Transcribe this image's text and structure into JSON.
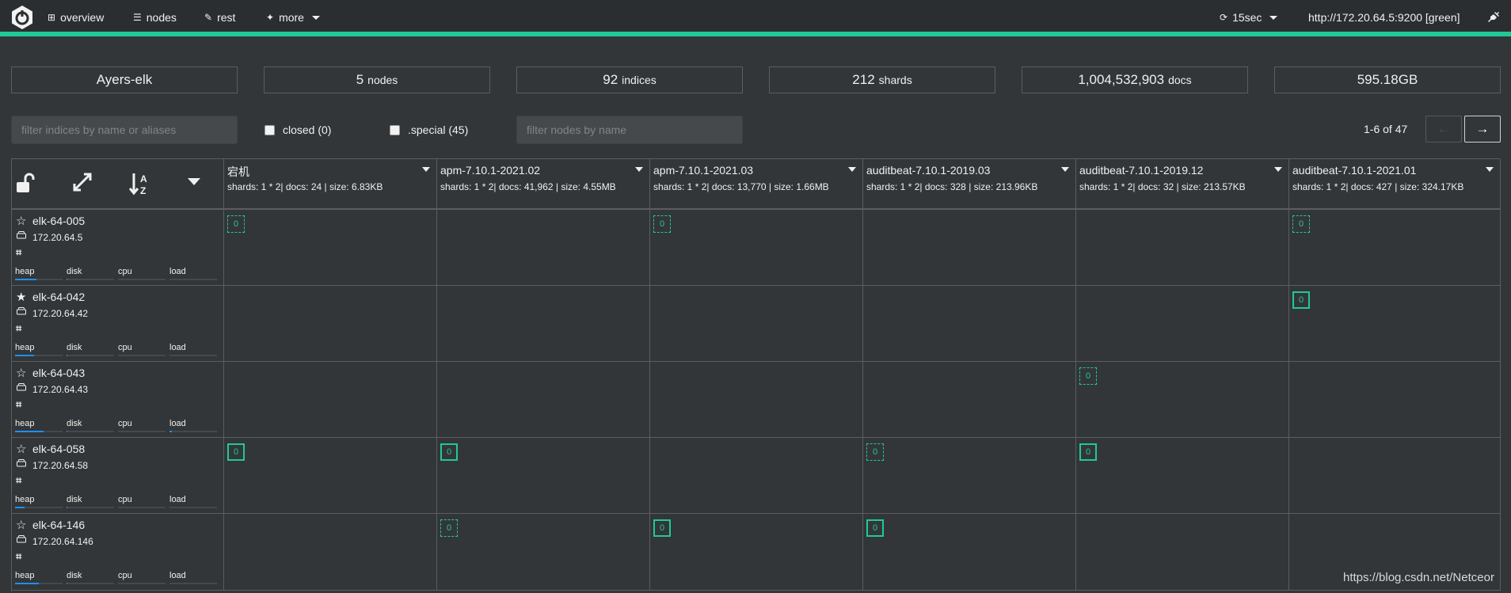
{
  "navbar": {
    "items": [
      {
        "label": "overview",
        "icon": "sitemap-icon"
      },
      {
        "label": "nodes",
        "icon": "server-icon"
      },
      {
        "label": "rest",
        "icon": "edit-icon"
      },
      {
        "label": "more",
        "icon": "wand-icon"
      }
    ],
    "refresh": "15sec",
    "cluster_url": "http://172.20.64.5:9200 [green]"
  },
  "stats": {
    "cluster_name": "Ayers-elk",
    "nodes_count": "5",
    "nodes_label": "nodes",
    "indices_count": "92",
    "indices_label": "indices",
    "shards_count": "212",
    "shards_label": "shards",
    "docs_count": "1,004,532,903",
    "docs_label": "docs",
    "size": "595.18GB"
  },
  "filters": {
    "indices_placeholder": "filter indices by name or aliases",
    "closed_label": "closed (0)",
    "special_label": ".special (45)",
    "nodes_placeholder": "filter nodes by name",
    "pagination": "1-6 of 47",
    "prev": "←",
    "next": "→"
  },
  "indices": [
    {
      "name": "宕机",
      "meta": "shards: 1 * 2| docs: 24 | size: 6.83KB"
    },
    {
      "name": "apm-7.10.1-2021.02",
      "meta": "shards: 1 * 2| docs: 41,962 | size: 4.55MB"
    },
    {
      "name": "apm-7.10.1-2021.03",
      "meta": "shards: 1 * 2| docs: 13,770 | size: 1.66MB"
    },
    {
      "name": "auditbeat-7.10.1-2019.03",
      "meta": "shards: 1 * 2| docs: 328 | size: 213.96KB"
    },
    {
      "name": "auditbeat-7.10.1-2019.12",
      "meta": "shards: 1 * 2| docs: 32 | size: 213.57KB"
    },
    {
      "name": "auditbeat-7.10.1-2021.01",
      "meta": "shards: 1 * 2| docs: 427 | size: 324.17KB"
    }
  ],
  "nodes": [
    {
      "name": "elk-64-005",
      "ip": "172.20.64.5",
      "master": false,
      "heap": 0.45,
      "load": 0.0
    },
    {
      "name": "elk-64-042",
      "ip": "172.20.64.42",
      "master": true,
      "heap": 0.4,
      "load": 0.0
    },
    {
      "name": "elk-64-043",
      "ip": "172.20.64.43",
      "master": false,
      "heap": 0.6,
      "load": 0.05
    },
    {
      "name": "elk-64-058",
      "ip": "172.20.64.58",
      "master": false,
      "heap": 0.2,
      "load": 0.0
    },
    {
      "name": "elk-64-146",
      "ip": "172.20.64.146",
      "master": false,
      "heap": 0.5,
      "load": 0.0
    }
  ],
  "metric_labels": [
    "heap",
    "disk",
    "cpu",
    "load"
  ],
  "shards": [
    [
      {
        "label": "0",
        "type": "replica"
      },
      null,
      {
        "label": "0",
        "type": "replica"
      },
      null,
      null,
      {
        "label": "0",
        "type": "replica"
      }
    ],
    [
      null,
      null,
      null,
      null,
      null,
      {
        "label": "0",
        "type": "primary"
      }
    ],
    [
      null,
      null,
      null,
      null,
      {
        "label": "0",
        "type": "replica"
      },
      null
    ],
    [
      {
        "label": "0",
        "type": "primary"
      },
      {
        "label": "0",
        "type": "primary"
      },
      null,
      {
        "label": "0",
        "type": "replica"
      },
      {
        "label": "0",
        "type": "primary"
      },
      null
    ],
    [
      null,
      {
        "label": "0",
        "type": "replica"
      },
      {
        "label": "0",
        "type": "primary"
      },
      {
        "label": "0",
        "type": "primary"
      },
      null,
      null
    ]
  ],
  "watermark": "https://blog.csdn.net/Netceor"
}
